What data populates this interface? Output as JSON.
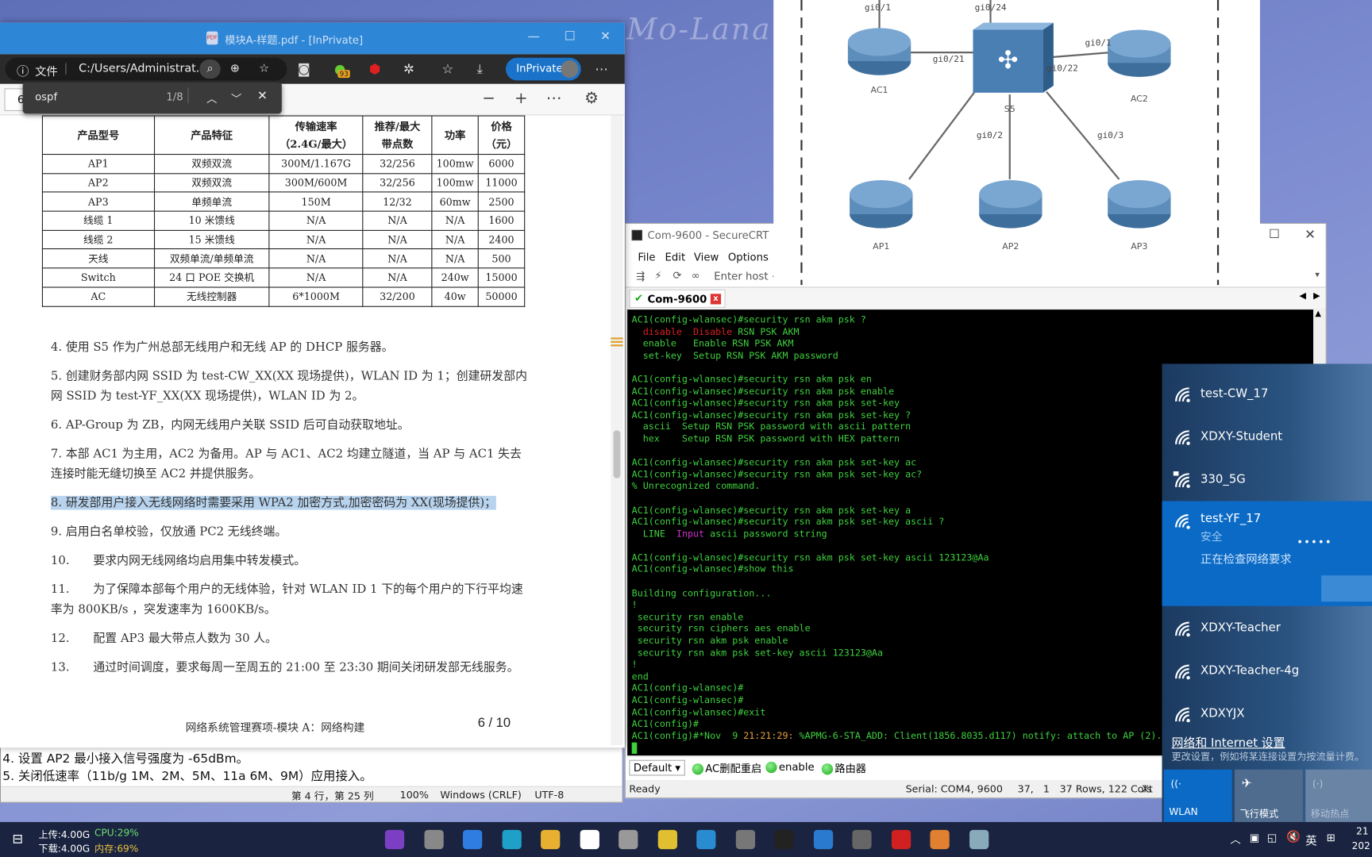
{
  "watermark": "Mo-Lana",
  "edge": {
    "title": "模块A-样题.pdf - [InPrivate]",
    "info_label": "文件",
    "address": "C:/Users/Administrat...",
    "extension_badge": "93",
    "inprivate_label": "InPrivate",
    "page_input": "6",
    "find": {
      "query": "ospf",
      "count": "1/8"
    }
  },
  "pdf": {
    "table": {
      "headers": [
        "产品型号",
        "产品特征",
        "传输速率\n（2.4G/最大）",
        "推荐/最大\n带点数",
        "功率",
        "价格\n（元）"
      ],
      "rows": [
        [
          "AP1",
          "双频双流",
          "300M/1.167G",
          "32/256",
          "100mw",
          "6000"
        ],
        [
          "AP2",
          "双频双流",
          "300M/600M",
          "32/256",
          "100mw",
          "11000"
        ],
        [
          "AP3",
          "单频单流",
          "150M",
          "12/32",
          "60mw",
          "2500"
        ],
        [
          "线缆 1",
          "10 米馈线",
          "N/A",
          "N/A",
          "N/A",
          "1600"
        ],
        [
          "线缆 2",
          "15 米馈线",
          "N/A",
          "N/A",
          "N/A",
          "2400"
        ],
        [
          "天线",
          "双频单流/单频单流",
          "N/A",
          "N/A",
          "N/A",
          "500"
        ],
        [
          "Switch",
          "24 口 POE 交换机",
          "N/A",
          "N/A",
          "240w",
          "15000"
        ],
        [
          "AC",
          "无线控制器",
          "6*1000M",
          "32/200",
          "40w",
          "50000"
        ]
      ]
    },
    "items": [
      "4. 使用 S5 作为广州总部无线用户和无线 AP 的 DHCP 服务器。",
      "5. 创建财务部内网 SSID 为 test-CW_XX(XX 现场提供)，WLAN ID 为 1；创建研发部内网 SSID 为 test-YF_XX(XX 现场提供)，WLAN ID 为 2。",
      "6. AP-Group 为 ZB，内网无线用户关联 SSID 后可自动获取地址。",
      "7. 本部 AC1 为主用，AC2 为备用。AP 与 AC1、AC2 均建立隧道，当 AP 与 AC1 失去连接时能无缝切换至 AC2 并提供服务。",
      "8. 研发部用户接入无线网络时需要采用 WPA2 加密方式,加密密码为 XX(现场提供)；",
      "9. 启用白名单校验，仅放通 PC2 无线终端。",
      "10.　　要求内网无线网络均启用集中转发模式。",
      "11.　　为了保障本部每个用户的无线体验，针对 WLAN ID 1 下的每个用户的下行平均速率为 800KB/s ，突发速率为 1600KB/s。",
      "12.　　配置 AP3 最大带点人数为 30 人。",
      "13.　　通过时间调度，要求每周一至周五的 21:00 至 23:30 期间关闭研发部无线服务。"
    ],
    "footer": "网络系统管理赛项-模块 A：网络构建",
    "page": "6 / 10"
  },
  "notepad": {
    "lines": [
      "4. 设置 AP2 最小接入信号强度为 -65dBm。",
      "5. 关闭低速率（11b/g 1M、2M、5M、11a 6M、9M）应用接入。"
    ],
    "status": {
      "position": "第 4 行，第 25 列",
      "zoom": "100%",
      "eol": "Windows (CRLF)",
      "encoding": "UTF-8"
    }
  },
  "diagram": {
    "nodes": [
      "AC1",
      "AC2",
      "S5",
      "AP1",
      "AP2",
      "AP3"
    ],
    "ports": [
      "gi0/1",
      "gi0/24",
      "gi0/21",
      "gi0/1",
      "gi0/22",
      "gi0/2",
      "gi0/3"
    ]
  },
  "crt": {
    "title": "Com-9600 - SecureCRT",
    "menu": [
      "File",
      "Edit",
      "View",
      "Options"
    ],
    "host_placeholder": "Enter host <",
    "tab": "Com-9600",
    "terminal": [
      [
        [
          "AC1(config-wlansec)#security rsn akm psk ?",
          "g"
        ]
      ],
      [
        [
          "  disable  Disable",
          "r"
        ],
        [
          " RSN PSK AKM",
          "g"
        ]
      ],
      [
        [
          "  enable   Enable RSN PSK AKM",
          "g"
        ]
      ],
      [
        [
          "  set-key  Setup RSN PSK AKM password",
          "g"
        ]
      ],
      [],
      [
        [
          "AC1(config-wlansec)#security rsn akm psk en",
          "g"
        ]
      ],
      [
        [
          "AC1(config-wlansec)#security rsn akm psk enable",
          "g"
        ]
      ],
      [
        [
          "AC1(config-wlansec)#security rsn akm psk set-key",
          "g"
        ]
      ],
      [
        [
          "AC1(config-wlansec)#security rsn akm psk set-key ?",
          "g"
        ]
      ],
      [
        [
          "  ascii  Setup RSN PSK password with ascii pattern",
          "g"
        ]
      ],
      [
        [
          "  hex    Setup RSN PSK password with HEX pattern",
          "g"
        ]
      ],
      [],
      [
        [
          "AC1(config-wlansec)#security rsn akm psk set-key ac",
          "g"
        ]
      ],
      [
        [
          "AC1(config-wlansec)#security rsn akm psk set-key ac?",
          "g"
        ]
      ],
      [
        [
          "% Unrecognized command.",
          "g"
        ]
      ],
      [],
      [
        [
          "AC1(config-wlansec)#security rsn akm psk set-key a",
          "g"
        ]
      ],
      [
        [
          "AC1(config-wlansec)#security rsn akm psk set-key ascii ?",
          "g"
        ]
      ],
      [
        [
          "  LINE  ",
          "g"
        ],
        [
          "Input",
          "m"
        ],
        [
          " ascii password string",
          "g"
        ]
      ],
      [],
      [
        [
          "AC1(config-wlansec)#security rsn akm psk set-key ascii 123123@Aa",
          "g"
        ]
      ],
      [
        [
          "AC1(config-wlansec)#show this",
          "g"
        ]
      ],
      [],
      [
        [
          "Building configuration...",
          "g"
        ]
      ],
      [
        [
          "!",
          "g"
        ]
      ],
      [
        [
          " security rsn enable",
          "g"
        ]
      ],
      [
        [
          " security rsn ciphers aes enable",
          "g"
        ]
      ],
      [
        [
          " security rsn akm psk enable",
          "g"
        ]
      ],
      [
        [
          " security rsn akm psk set-key ascii 123123@Aa",
          "g"
        ]
      ],
      [
        [
          "!",
          "g"
        ]
      ],
      [
        [
          "end",
          "g"
        ]
      ],
      [
        [
          "AC1(config-wlansec)#",
          "g"
        ]
      ],
      [
        [
          "AC1(config-wlansec)#",
          "g"
        ]
      ],
      [
        [
          "AC1(config-wlansec)#exit",
          "g"
        ]
      ],
      [
        [
          "AC1(config)#",
          "g"
        ]
      ],
      [
        [
          "AC1(config)#*Nov  9 ",
          "g"
        ],
        [
          "21:21:29:",
          "o"
        ],
        [
          " %APMG-6-STA_ADD: Client(1856.8035.d117) notify: attach to AP (2).",
          "g"
        ]
      ]
    ],
    "terminal_colors": {
      "g": "#3fd13f",
      "r": "#e02020",
      "m": "#d030d0",
      "o": "#e8a040"
    },
    "buttons": {
      "session": "Default",
      "b1": "AC删配重启",
      "b2": "enable",
      "b3": "路由器"
    },
    "status": {
      "ready": "Ready",
      "serial": "Serial: COM4, 9600",
      "cursor": "37,   1",
      "size": "37 Rows, 122 Cols",
      "term": "Xt"
    }
  },
  "wifi": {
    "networks": [
      {
        "name": "test-CW_17",
        "secured": false
      },
      {
        "name": "XDXY-Student",
        "secured": false
      },
      {
        "name": "330_5G",
        "secured": true
      }
    ],
    "selected": {
      "name": "test-YF_17",
      "status": "安全",
      "progress": "正在检查网络要求"
    },
    "more": [
      {
        "name": "XDXY-Teacher"
      },
      {
        "name": "XDXY-Teacher-4g"
      },
      {
        "name": "XDXYJX"
      }
    ],
    "settings_link": "网络和 Internet 设置",
    "settings_desc": "更改设置，例如将某连接设置为按流量计费。",
    "tiles": [
      "WLAN",
      "飞行模式",
      "移动热点"
    ]
  },
  "taskbar": {
    "upload": "上传:4.00G",
    "cpu": "CPU:29%",
    "download": "下载:4.00G",
    "mem": "内存:69%",
    "ime": "英",
    "time": "21",
    "date": "202"
  }
}
